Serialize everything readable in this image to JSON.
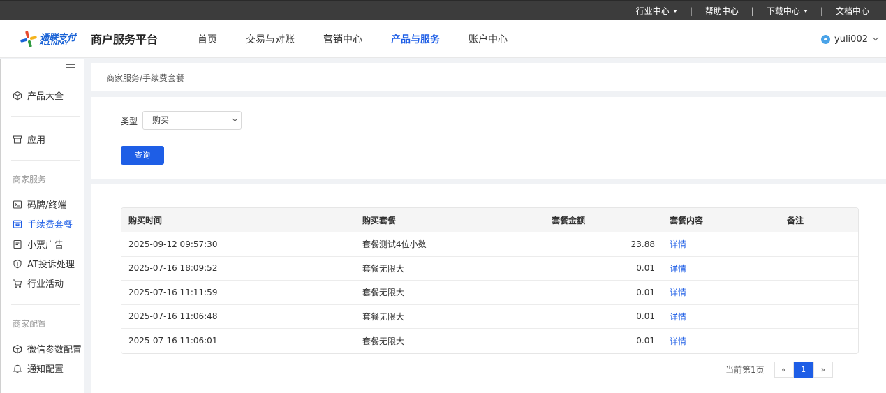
{
  "topbar": {
    "links": [
      {
        "label": "行业中心",
        "dropdown": true
      },
      {
        "label": "帮助中心",
        "dropdown": false
      },
      {
        "label": "下载中心",
        "dropdown": true
      },
      {
        "label": "文档中心",
        "dropdown": false
      }
    ]
  },
  "header": {
    "logo_text": "通联支付",
    "logo_text_en": "ALLINPAY",
    "platform_title": "商户服务平台",
    "nav": [
      "首页",
      "交易与对账",
      "营销中心",
      "产品与服务",
      "账户中心"
    ],
    "active_nav": "产品与服务",
    "username": "yuli002"
  },
  "sidebar": {
    "top_items": [
      {
        "label": "产品大全",
        "icon": "cube-icon"
      },
      {
        "label": "应用",
        "icon": "box-icon"
      }
    ],
    "group1_title": "商家服务",
    "group1_items": [
      {
        "label": "码牌/终端",
        "icon": "terminal-icon"
      },
      {
        "label": "手续费套餐",
        "icon": "package-icon",
        "active": true
      },
      {
        "label": "小票广告",
        "icon": "receipt-icon"
      },
      {
        "label": "AT投诉处理",
        "icon": "shield-icon"
      },
      {
        "label": "行业活动",
        "icon": "cart-icon"
      }
    ],
    "group2_title": "商家配置",
    "group2_items": [
      {
        "label": "微信参数配置",
        "icon": "cube-icon"
      },
      {
        "label": "通知配置",
        "icon": "bell-icon"
      }
    ]
  },
  "breadcrumb": "商家服务/手续费套餐",
  "filter": {
    "type_label": "类型",
    "type_value": "购买",
    "query_button": "查询"
  },
  "table": {
    "columns": [
      "购买时间",
      "购买套餐",
      "套餐金额",
      "套餐内容",
      "备注"
    ],
    "rows": [
      {
        "time": "2025-09-12 09:57:30",
        "package": "套餐测试4位小数",
        "amount": "23.88",
        "content": "详情",
        "remark": ""
      },
      {
        "time": "2025-07-16 18:09:52",
        "package": "套餐无限大",
        "amount": "0.01",
        "content": "详情",
        "remark": ""
      },
      {
        "time": "2025-07-16 11:11:59",
        "package": "套餐无限大",
        "amount": "0.01",
        "content": "详情",
        "remark": ""
      },
      {
        "time": "2025-07-16 11:06:48",
        "package": "套餐无限大",
        "amount": "0.01",
        "content": "详情",
        "remark": ""
      },
      {
        "time": "2025-07-16 11:06:01",
        "package": "套餐无限大",
        "amount": "0.01",
        "content": "详情",
        "remark": ""
      }
    ]
  },
  "pager": {
    "text": "当前第1页",
    "prev": "«",
    "current": "1",
    "next": "»"
  }
}
